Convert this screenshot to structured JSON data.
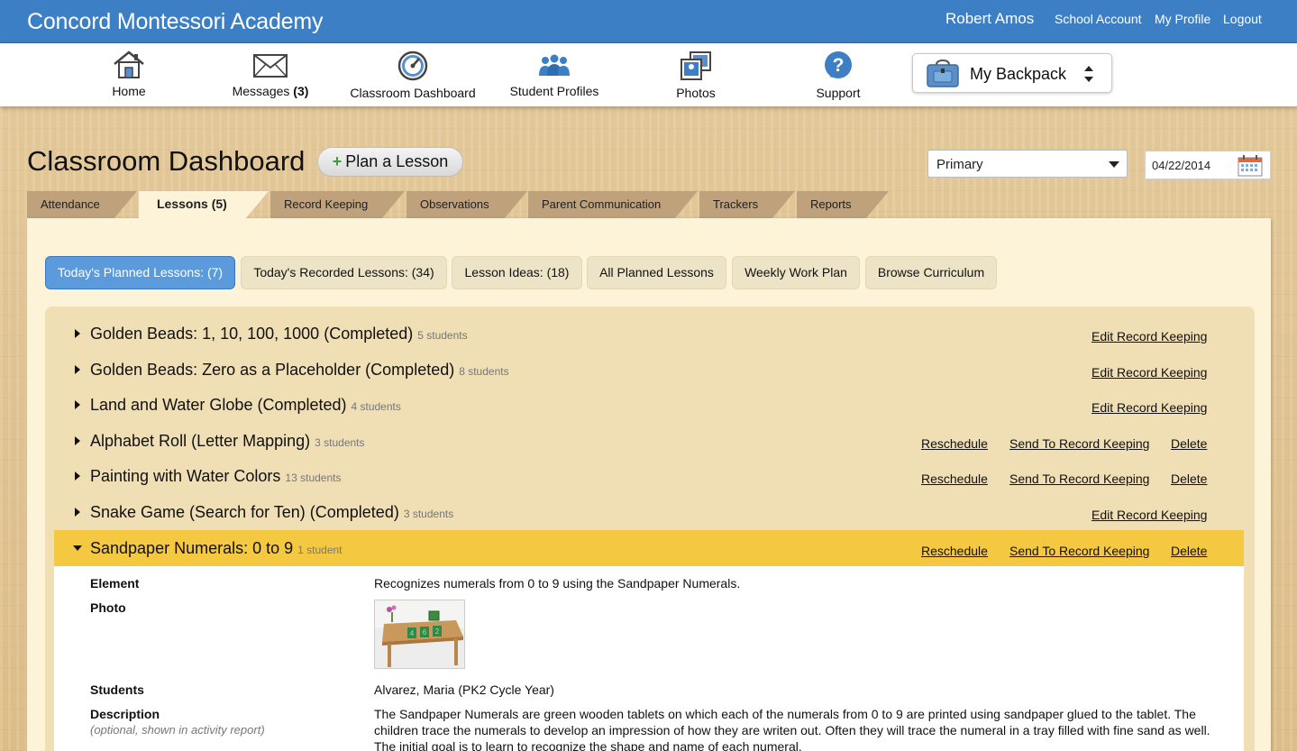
{
  "header": {
    "school_name": "Concord Montessori Academy",
    "user_name": "Robert Amos",
    "links": [
      "School Account",
      "My Profile",
      "Logout"
    ]
  },
  "nav": {
    "items": [
      {
        "label": "Home",
        "icon": "home-icon"
      },
      {
        "label": "Messages",
        "count": "(3)",
        "icon": "envelope-icon"
      },
      {
        "label": "Classroom Dashboard",
        "icon": "dashboard-gauge-icon"
      },
      {
        "label": "Student Profiles",
        "icon": "people-icon"
      },
      {
        "label": "Photos",
        "icon": "photos-icon"
      },
      {
        "label": "Support",
        "icon": "question-icon"
      }
    ],
    "backpack_label": "My Backpack"
  },
  "page": {
    "title": "Classroom Dashboard",
    "plan_button": "Plan a Lesson",
    "level_select": "Primary",
    "date": "04/22/2014"
  },
  "tabs": [
    {
      "label": "Attendance"
    },
    {
      "label": "Lessons (5)",
      "active": true
    },
    {
      "label": "Record Keeping"
    },
    {
      "label": "Observations"
    },
    {
      "label": "Parent Communication"
    },
    {
      "label": "Trackers"
    },
    {
      "label": "Reports"
    }
  ],
  "subtabs": [
    {
      "label": "Today's Planned Lessons: (7)",
      "active": true
    },
    {
      "label": "Today's Recorded Lessons: (34)"
    },
    {
      "label": "Lesson Ideas: (18)"
    },
    {
      "label": "All Planned Lessons"
    },
    {
      "label": "Weekly Work Plan"
    },
    {
      "label": "Browse Curriculum"
    }
  ],
  "lessons": [
    {
      "title": "Golden Beads: 1, 10, 100, 1000 (Completed)",
      "count": "5 students",
      "actions": [
        "Edit Record Keeping"
      ]
    },
    {
      "title": "Golden Beads: Zero as a Placeholder (Completed)",
      "count": "8 students",
      "actions": [
        "Edit Record Keeping"
      ]
    },
    {
      "title": "Land and Water Globe (Completed)",
      "count": "4 students",
      "actions": [
        "Edit Record Keeping"
      ]
    },
    {
      "title": "Alphabet Roll (Letter Mapping)",
      "count": "3 students",
      "actions": [
        "Reschedule",
        "Send To Record Keeping",
        "Delete"
      ]
    },
    {
      "title": "Painting with Water Colors",
      "count": "13 students",
      "actions": [
        "Reschedule",
        "Send To Record Keeping",
        "Delete"
      ]
    },
    {
      "title": "Snake Game (Search for Ten) (Completed)",
      "count": "3 students",
      "actions": [
        "Edit Record Keeping"
      ]
    },
    {
      "title": "Sandpaper Numerals: 0 to 9",
      "count": "1 student",
      "actions": [
        "Reschedule",
        "Send To Record Keeping",
        "Delete"
      ],
      "expanded": true
    }
  ],
  "detail": {
    "element_label": "Element",
    "element_value": "Recognizes numerals from 0 to 9 using the Sandpaper Numerals.",
    "photo_label": "Photo",
    "students_label": "Students",
    "students_value": "Alvarez, Maria (PK2 Cycle Year)",
    "description_label": "Description",
    "description_note": "(optional, shown in activity report)",
    "description_value": "The Sandpaper Numerals are green wooden tablets on which each of the numerals from 0 to 9 are printed using sandpaper glued to the tablet. The children trace the numerals to develop an impression of how they are writen out. Often they will trace the numeral in a tray filled with fine sand as well. The initial goal is to learn to recognize the shape and name of each numeral.",
    "photo_tiles": [
      "4",
      "6",
      "2"
    ]
  },
  "colors": {
    "header_blue": "#3d7fc5",
    "active_subtab": "#5b9bdc",
    "expanded_row": "#f5c842",
    "tab_brown": "#bfa17c",
    "panel_cream": "#fcf3d8"
  }
}
